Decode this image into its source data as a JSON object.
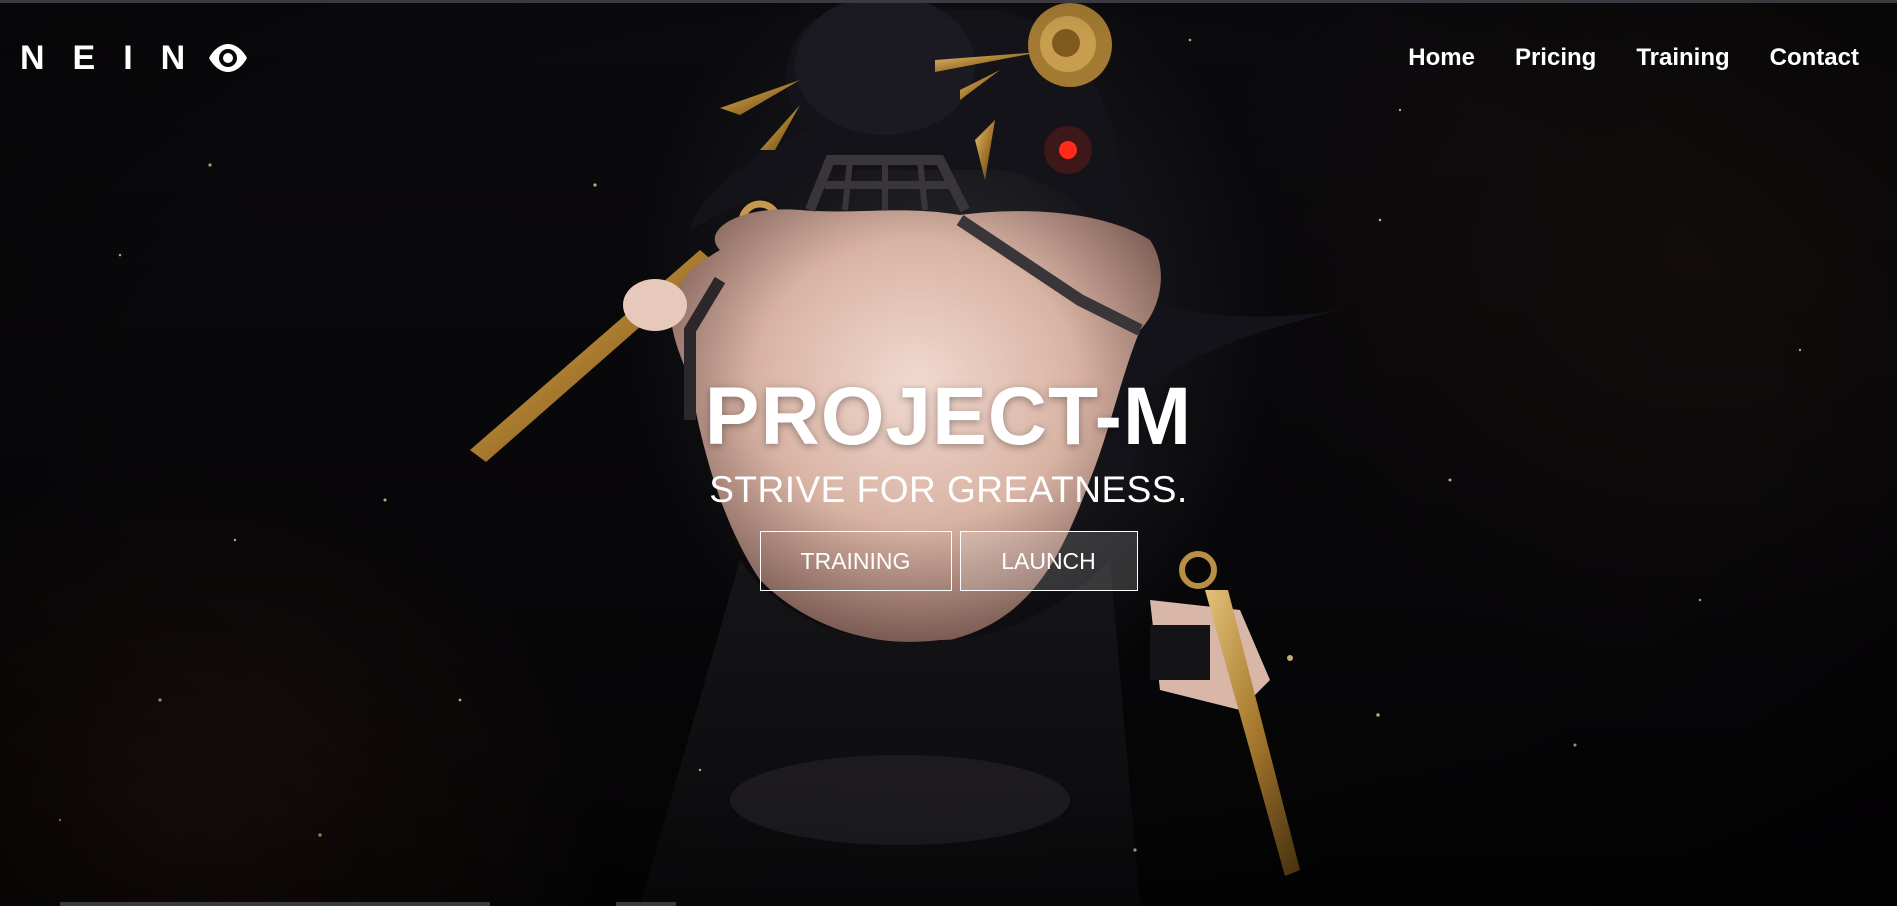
{
  "colors": {
    "background": "#07060a",
    "text": "#ffffff",
    "accent_gold": "#b8893a",
    "eye_red": "#ff2a18"
  },
  "brand": {
    "name": "NEIN",
    "logo_icon": "eye-icon"
  },
  "nav": {
    "items": [
      {
        "label": "Home"
      },
      {
        "label": "Pricing"
      },
      {
        "label": "Training"
      },
      {
        "label": "Contact"
      }
    ]
  },
  "hero": {
    "background_image": "dark anime illustration of a woman seen from behind holding gold daggers",
    "title": "PROJECT-M",
    "tagline": "STRIVE FOR GREATNESS.",
    "buttons": {
      "training_label": "TRAINING",
      "launch_label": "LAUNCH"
    }
  }
}
